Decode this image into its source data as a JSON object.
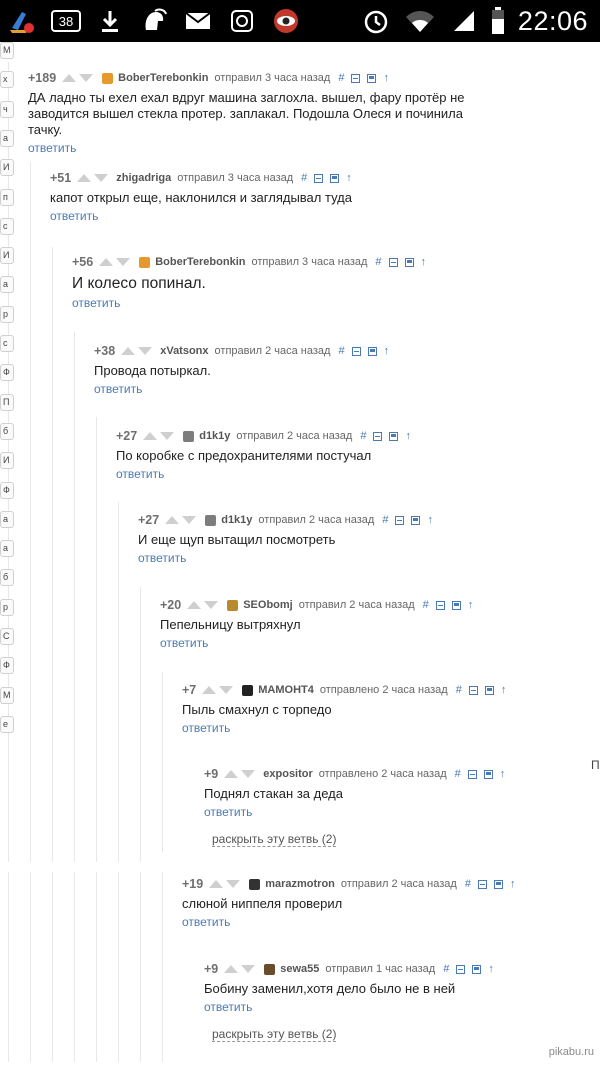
{
  "status_bar": {
    "time": "22:06",
    "notification_count": "38",
    "icons_left": [
      "cleaner-app-icon",
      "notification-badge-icon",
      "download-icon",
      "spartan-helmet-icon",
      "mail-icon",
      "app-icon",
      "eye-icon"
    ],
    "icons_right": [
      "alarm-icon",
      "wifi-icon",
      "signal-icon",
      "battery-icon"
    ]
  },
  "comments": [
    {
      "rating": "+189",
      "author": "BoberTerebonkin",
      "meta": "отправил 3 часа назад",
      "text": "ДА ладно ты exeл ехал вдруг машина заглохла. вышел, фару протёр не заводится вышел стекла протер. заплакал. Подошла Олеся и починила тачку.",
      "reply": "ответить",
      "avatar_color": "#e69a2e"
    },
    {
      "rating": "+51",
      "author": "zhigadriga",
      "meta": "отправил 3 часа назад",
      "text": "капот открыл еще, наклонился и заглядывал туда",
      "reply": "ответить",
      "avatar_color": ""
    },
    {
      "rating": "+56",
      "author": "BoberTerebonkin",
      "meta": "отправил 3 часа назад",
      "text": "И колесо попинал.",
      "reply": "ответить",
      "avatar_color": "#e69a2e"
    },
    {
      "rating": "+38",
      "author": "xVatsonx",
      "meta": "отправил 2 часа назад",
      "text": "Провода потыркал.",
      "reply": "ответить",
      "avatar_color": ""
    },
    {
      "rating": "+27",
      "author": "d1k1y",
      "meta": "отправил 2 часа назад",
      "text": "По коробке с предохранителями постучал",
      "reply": "ответить",
      "avatar_color": "#7d7d7d"
    },
    {
      "rating": "+27",
      "author": "d1k1y",
      "meta": "отправил 2 часа назад",
      "text": "И еще щуп вытащил посмотреть",
      "reply": "ответить",
      "avatar_color": "#7d7d7d"
    },
    {
      "rating": "+20",
      "author": "SEObomj",
      "meta": "отправил 2 часа назад",
      "text": "Пепельницу вытряхнул",
      "reply": "ответить",
      "avatar_color": "#b9892f"
    },
    {
      "rating": "+7",
      "author": "МАМОНТ4",
      "meta": "отправлено 2 часа назад",
      "text": "Пыль смахнул с торпедо",
      "reply": "ответить",
      "avatar_color": "#222222"
    },
    {
      "rating": "+9",
      "author": "expositor",
      "meta": "отправлено 2 часа назад",
      "text": "Поднял стакан за деда",
      "reply": "ответить",
      "avatar_color": ""
    },
    {
      "rating": "+19",
      "author": "marazmotron",
      "meta": "отправил 2 часа назад",
      "text": "слюной ниппеля проверил",
      "reply": "ответить",
      "avatar_color": "#333333"
    },
    {
      "rating": "+9",
      "author": "sewa55",
      "meta": "отправил 1 час назад",
      "text": "Бобину заменил,хотя дело было не в ней",
      "reply": "ответить",
      "avatar_color": "#6b4b2a"
    }
  ],
  "expand_links": [
    "раскрыть эту ветвь (2)",
    "раскрыть эту ветвь (2)"
  ],
  "action_icons": [
    "hash-link-icon",
    "collapse-icon",
    "save-icon",
    "parent-arrow-icon"
  ],
  "action_hash": "#",
  "action_arrow": "↑",
  "sidebar_letters": [
    "M",
    "x",
    "ч",
    "a",
    "И",
    "п",
    "c",
    "И",
    "a",
    "p",
    "c",
    "Ф",
    "П",
    "б",
    "И",
    "Ф",
    "a",
    "a",
    "б",
    "p",
    "C",
    "Ф",
    "M",
    "e"
  ],
  "sidebar_tail": "По",
  "watermark": "pikabu.ru",
  "colors": {
    "link": "#4a7ab4",
    "rating": "#6f6f6f",
    "vote_arrow": "#cfcfcf"
  }
}
